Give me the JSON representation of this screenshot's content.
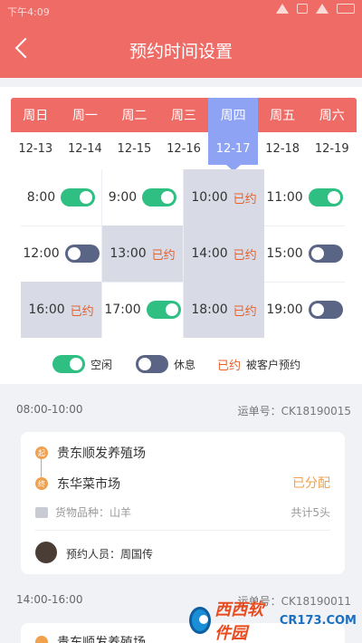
{
  "statusbar": {
    "time": "下午4:09"
  },
  "header": {
    "title": "预约时间设置"
  },
  "week": {
    "days": [
      "周日",
      "周一",
      "周二",
      "周三",
      "周四",
      "周五",
      "周六"
    ],
    "dates": [
      "12-13",
      "12-14",
      "12-15",
      "12-16",
      "12-17",
      "12-18",
      "12-19"
    ],
    "selected_index": 4
  },
  "slots": [
    {
      "time": "8:00",
      "state": "on"
    },
    {
      "time": "9:00",
      "state": "on"
    },
    {
      "time": "10:00",
      "state": "booked",
      "tag": "已约"
    },
    {
      "time": "11:00",
      "state": "on"
    },
    {
      "time": "12:00",
      "state": "off"
    },
    {
      "time": "13:00",
      "state": "booked",
      "tag": "已约"
    },
    {
      "time": "14:00",
      "state": "booked",
      "tag": "已约"
    },
    {
      "time": "15:00",
      "state": "off"
    },
    {
      "time": "16:00",
      "state": "booked",
      "tag": "已约"
    },
    {
      "time": "17:00",
      "state": "on"
    },
    {
      "time": "18:00",
      "state": "booked",
      "tag": "已约"
    },
    {
      "time": "19:00",
      "state": "off"
    }
  ],
  "legend": {
    "free": "空闲",
    "rest": "休息",
    "booked_tag": "已约",
    "booked_desc": "被客户预约"
  },
  "orders": [
    {
      "time_range": "08:00-10:00",
      "waybill": "运单号：CK18190015",
      "origin_marker": "起",
      "origin": "贵东顺发养殖场",
      "dest_marker": "终",
      "destination": "东华菜市场",
      "status": "已分配",
      "goods": "货物品种：山羊",
      "total": "共计5头",
      "booker": "预约人员：周国传"
    },
    {
      "time_range": "14:00-16:00",
      "waybill": "运单号：CK18190011",
      "origin": "贵东顺发养殖场"
    }
  ],
  "watermark": {
    "text": "西西软件园",
    "sub": "CR173.COM"
  },
  "colors": {
    "accent": "#ee6b66",
    "selected": "#8fa3f5",
    "toggle_on": "#2fbf83",
    "toggle_off": "#5a6585",
    "booked": "#e8602a",
    "orange": "#f0a14e"
  }
}
